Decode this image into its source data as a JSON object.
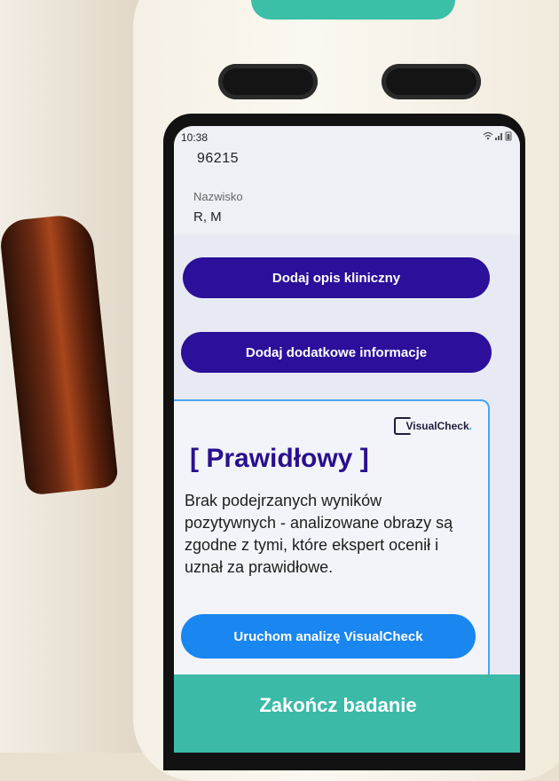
{
  "status": {
    "time": "10:38",
    "icons": "wifi-signal-battery"
  },
  "patient": {
    "id": "96215",
    "name_label": "Nazwisko",
    "name_value": "R, M"
  },
  "buttons": {
    "clinical": "Dodaj opis kliniczny",
    "additional": "Dodaj dodatkowe informacje",
    "run_analysis": "Uruchom analizę VisualCheck",
    "finish": "Zakończ badanie"
  },
  "result": {
    "logo_text": "VisualCheck",
    "logo_dot": ".",
    "title": "[ Prawidłowy ]",
    "description": "Brak podejrzanych wyników pozytywnych - analizowane obrazy są zgodne z tymi, które ekspert ocenił i uznał za prawidłowe."
  },
  "colors": {
    "primary_dark": "#2c0f9a",
    "accent_blue": "#1a86f0",
    "teal": "#3bbaa8",
    "card_border": "#4aa4f0"
  }
}
